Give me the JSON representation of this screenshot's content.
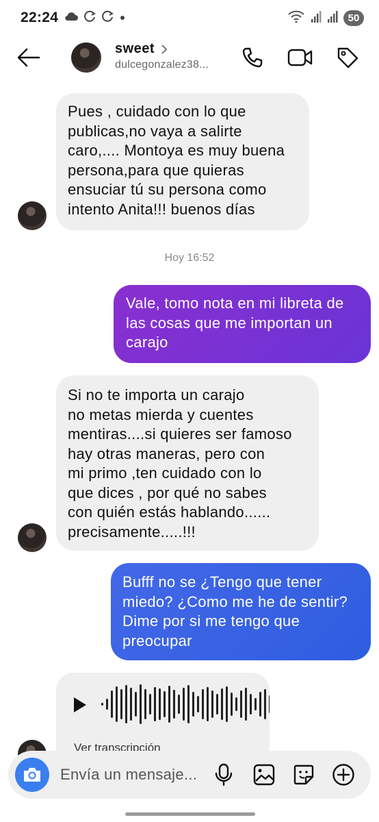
{
  "status_bar": {
    "time": "22:24",
    "battery": "50",
    "icons": [
      "cloud-icon",
      "sync-icon",
      "sync-icon",
      "dot-icon",
      "wifi-icon",
      "signal-icon",
      "signal-icon"
    ]
  },
  "header": {
    "name": "sweet",
    "username": "dulcegonzalez38...",
    "icons": [
      "back-arrow-icon",
      "chevron-right-icon",
      "phone-icon",
      "video-camera-icon",
      "tag-icon"
    ]
  },
  "messages": [
    {
      "direction": "incoming",
      "text": "Pues , cuidado con lo que\npublicas,no vaya a salirte\ncaro,.... Montoya es muy buena\npersona,para que quieras\nensuciar tú su persona como\nintento Anita!!! buenos días"
    },
    {
      "timestamp": "Hoy 16:52"
    },
    {
      "direction": "outgoing",
      "text": "Vale, tomo nota en mi libreta de\nlas cosas que me importan un\ncarajo"
    },
    {
      "direction": "incoming",
      "text": "Si no te importa un carajo\nno metas mierda y cuentes\nmentiras....si quieres ser famoso\nhay otras maneras, pero con\nmi primo ,ten cuidado con lo\nque dices , por qué no sabes\ncon quién estás hablando......\nprecisamente.....!!!"
    },
    {
      "direction": "outgoing",
      "text": "Bufff no se ¿Tengo que tener\nmiedo? ¿Como me he de sentir?\nDime por si me tengo que\npreocupar"
    },
    {
      "direction": "incoming",
      "type": "voice",
      "transcript_label": "Ver transcripción"
    }
  ],
  "composer": {
    "placeholder": "Envía un mensaje...",
    "icons": [
      "camera-icon",
      "microphone-icon",
      "image-icon",
      "sticker-icon",
      "plus-circle-icon"
    ]
  },
  "colors": {
    "outgoing_purple": "#7b32d4",
    "outgoing_blue": "#3a62e4",
    "incoming_bg": "#efefef",
    "camera_button": "#3a7ff0"
  }
}
